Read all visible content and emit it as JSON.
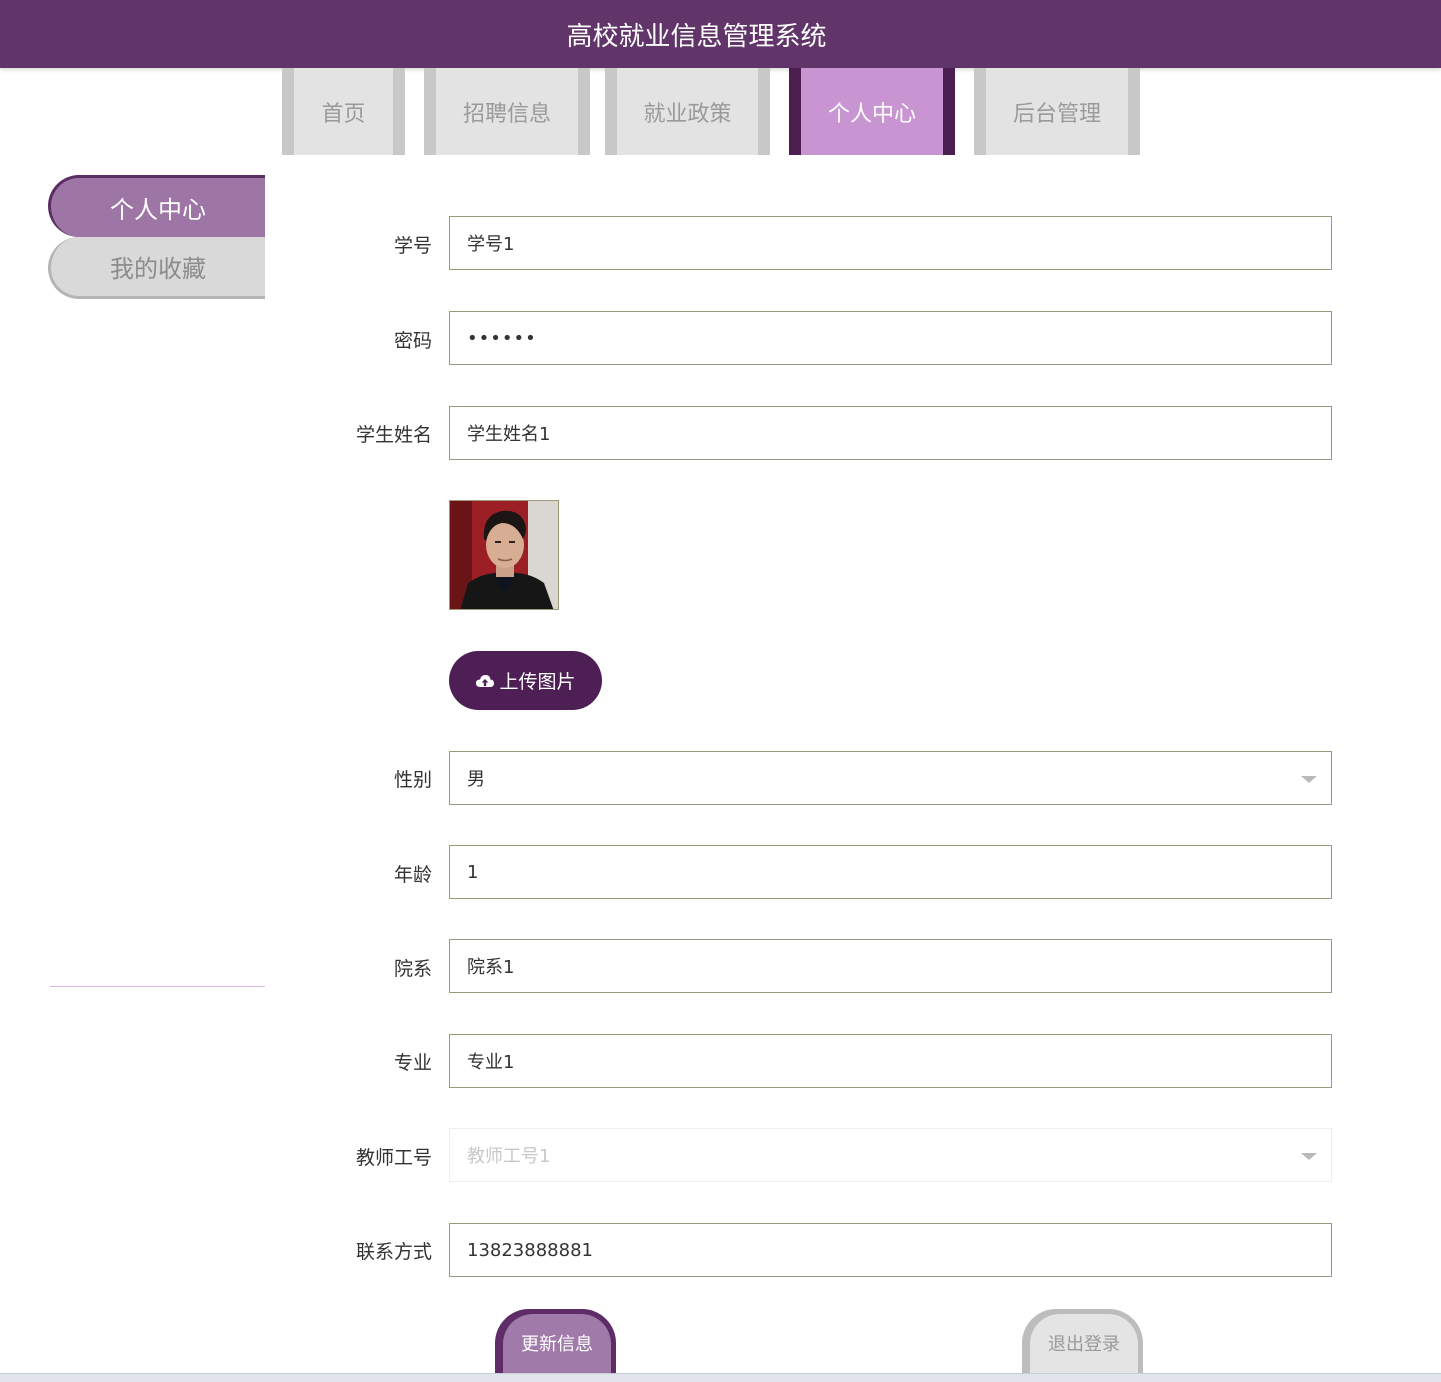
{
  "header": {
    "title": "高校就业信息管理系统"
  },
  "nav": {
    "tabs": [
      {
        "label": "首页"
      },
      {
        "label": "招聘信息"
      },
      {
        "label": "就业政策"
      },
      {
        "label": "个人中心"
      },
      {
        "label": "后台管理"
      }
    ],
    "active": "个人中心"
  },
  "sidebar": {
    "items": [
      {
        "label": "个人中心"
      },
      {
        "label": "我的收藏"
      }
    ]
  },
  "form": {
    "student_id": {
      "label": "学号",
      "value": "学号1"
    },
    "password": {
      "label": "密码",
      "value": "••••••"
    },
    "name": {
      "label": "学生姓名",
      "value": "学生姓名1"
    },
    "upload_label": "上传图片",
    "gender": {
      "label": "性别",
      "value": "男"
    },
    "age": {
      "label": "年龄",
      "value": "1"
    },
    "department": {
      "label": "院系",
      "value": "院系1"
    },
    "major": {
      "label": "专业",
      "value": "专业1"
    },
    "teacher_id": {
      "label": "教师工号",
      "value": "教师工号1"
    },
    "contact": {
      "label": "联系方式",
      "value": "13823888881"
    }
  },
  "actions": {
    "update": "更新信息",
    "logout": "退出登录"
  },
  "colors": {
    "header_bg": "#61356a",
    "nav_active_bg": "#c895d2",
    "upload_btn_bg": "#4d1f55",
    "side_active_bg": "#9e76a6"
  }
}
